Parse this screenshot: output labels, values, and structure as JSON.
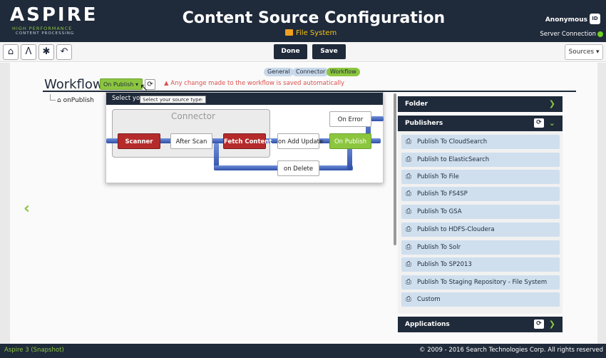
{
  "header": {
    "logo_main": "ASPIRE",
    "logo_sub1": "HIGH PERFORMANCE",
    "logo_sub2": "CONTENT PROCESSING",
    "title": "Content Source Configuration",
    "subtitle": "File System",
    "user": "Anonymous",
    "server_connection": "Server Connection"
  },
  "toolbar": {
    "icons": [
      "home-icon",
      "aspire-icon",
      "bug-icon",
      "back-icon"
    ],
    "done_label": "Done",
    "save_label": "Save",
    "sources_label": "Sources ▾"
  },
  "tabs": [
    "General",
    "Connector",
    "Workflow"
  ],
  "workflow": {
    "title": "Workflow",
    "selected": "On Publish",
    "warning": "Any change made to the workflow is saved automatically",
    "tree_item": "onPublish"
  },
  "popover": {
    "header": "Select you",
    "tooltip": "Select your source type:",
    "connector_label": "Connector",
    "nodes": {
      "scanner": "Scanner",
      "after_scan": "After Scan",
      "fetch_content": "Fetch Content",
      "on_add_update": "on Add Update",
      "on_publish": "On Publish",
      "on_error": "On Error",
      "on_delete": "on Delete"
    }
  },
  "right_panel": {
    "folder": "Folder",
    "publishers": "Publishers",
    "publisher_items": [
      "Publish To CloudSearch",
      "Publish to ElasticSearch",
      "Publish To File",
      "Publish To FS4SP",
      "Publish To GSA",
      "Publish to HDFS-Cloudera",
      "Publish To Solr",
      "Publish To SP2013",
      "Publish To Staging Repository - File System",
      "Custom"
    ],
    "applications": "Applications"
  },
  "footer": {
    "version": "Aspire 3 (Snapshot)",
    "copyright": "© 2009 - 2016 Search Technologies Corp. All rights reserved"
  },
  "colors": {
    "navy": "#1f2a3a",
    "green": "#8cc63f",
    "red_node": "#b52b2b",
    "pipe_blue": "#3e5fbf",
    "item_blue": "#cfdfee"
  }
}
